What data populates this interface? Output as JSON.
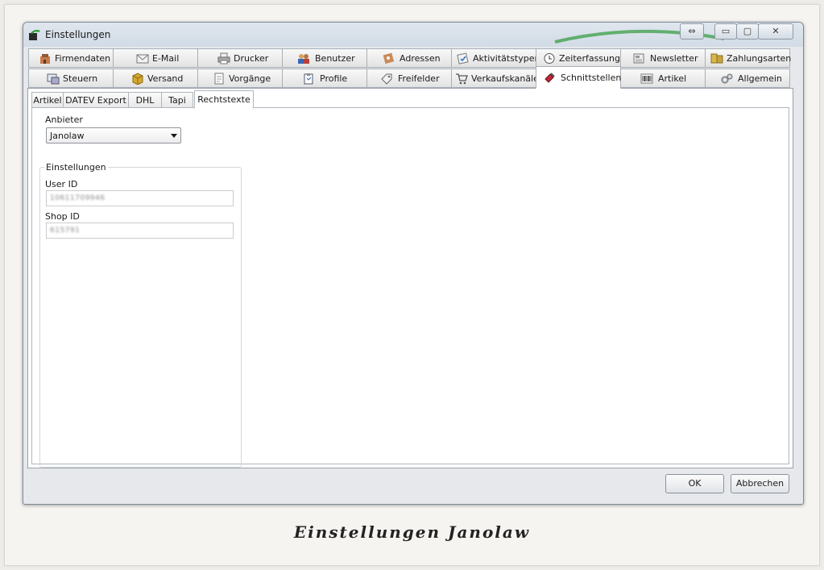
{
  "window": {
    "title": "Einstellungen",
    "controls": {
      "resize": "⇔",
      "minimize": "▭",
      "maximize": "▢",
      "close": "✕"
    }
  },
  "main_tabs": {
    "row1": [
      {
        "label": "Firmendaten",
        "icon": "building-icon"
      },
      {
        "label": "E-Mail",
        "icon": "envelope-icon"
      },
      {
        "label": "Drucker",
        "icon": "printer-icon"
      },
      {
        "label": "Benutzer",
        "icon": "users-icon"
      },
      {
        "label": "Adressen",
        "icon": "address-book-icon"
      },
      {
        "label": "Aktivitätstypen",
        "icon": "checklist-icon"
      },
      {
        "label": "Zeiterfassung",
        "icon": "clock-icon"
      },
      {
        "label": "Newsletter",
        "icon": "newsletter-icon"
      },
      {
        "label": "Zahlungsarten",
        "icon": "payment-icon"
      }
    ],
    "row2": [
      {
        "label": "Steuern",
        "icon": "tax-icon"
      },
      {
        "label": "Versand",
        "icon": "package-icon"
      },
      {
        "label": "Vorgänge",
        "icon": "document-icon"
      },
      {
        "label": "Profile",
        "icon": "clipboard-icon"
      },
      {
        "label": "Freifelder",
        "icon": "tag-icon"
      },
      {
        "label": "Verkaufskanäle",
        "icon": "cart-icon"
      },
      {
        "label": "Schnittstellen",
        "icon": "plug-icon",
        "active": true
      },
      {
        "label": "Artikel",
        "icon": "barcode-icon"
      },
      {
        "label": "Allgemein",
        "icon": "gears-icon"
      }
    ]
  },
  "sub_tabs": [
    {
      "label": "Artikel"
    },
    {
      "label": "DATEV Export"
    },
    {
      "label": "DHL"
    },
    {
      "label": "Tapi"
    },
    {
      "label": "Rechtstexte",
      "active": true
    }
  ],
  "form": {
    "provider_label": "Anbieter",
    "provider_value": "Janolaw",
    "group_title": "Einstellungen",
    "user_id_label": "User ID",
    "user_id_value": "10611709946",
    "shop_id_label": "Shop ID",
    "shop_id_value": "615791"
  },
  "buttons": {
    "ok": "OK",
    "cancel": "Abbrechen"
  },
  "caption": "Einstellungen Janolaw",
  "colors": {
    "accent_green": "#2f9a3a",
    "tab_border": "#a9afb6",
    "window_border": "#7f8b97"
  }
}
